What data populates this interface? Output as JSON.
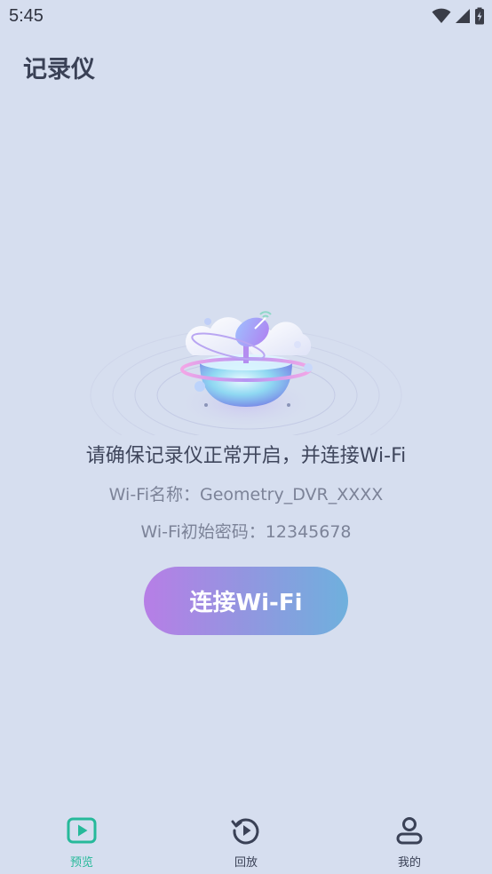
{
  "status_bar": {
    "time": "5:45",
    "icons": [
      "wifi-icon",
      "cellular-signal-icon",
      "battery-charging-icon"
    ]
  },
  "header": {
    "title": "记录仪"
  },
  "main": {
    "illustration": "dashcam-satellite-illustration",
    "message": "请确保记录仪正常开启，并连接Wi-Fi",
    "wifi_name": "Wi-Fi名称：Geometry_DVR_XXXX",
    "wifi_password": "Wi-Fi初始密码：12345678",
    "connect_button_label": "连接Wi-Fi"
  },
  "bottom_nav": {
    "items": [
      {
        "label": "预览",
        "icon": "play-icon",
        "active": true
      },
      {
        "label": "回放",
        "icon": "replay-icon",
        "active": false
      },
      {
        "label": "我的",
        "icon": "user-icon",
        "active": false
      }
    ]
  },
  "colors": {
    "background": "#d6deef",
    "accent": "#26b99a",
    "button_gradient_start": "#b77ee6",
    "button_gradient_end": "#6fb0dd"
  }
}
